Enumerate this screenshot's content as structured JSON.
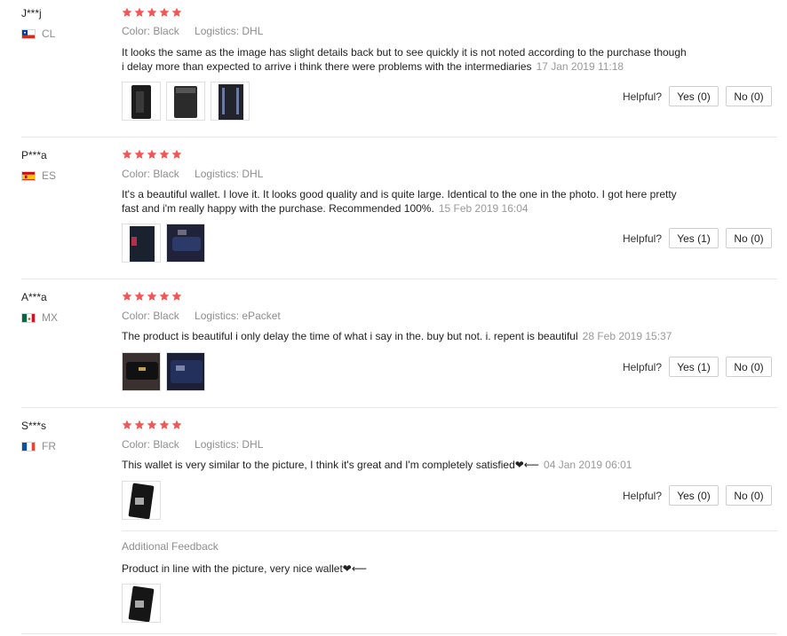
{
  "reviews": [
    {
      "user": "J***j",
      "country": "CL",
      "rating": 5,
      "color": "Color: Black",
      "logistics": "Logistics: DHL",
      "text": "It looks the same as the image has slight details back but to see quickly it is not noted according to the purchase though i delay more than expected to arrive i think there were problems with the intermediaries",
      "date": "17 Jan 2019 11:18",
      "photos": [
        "wallet-photo",
        "wallet-photo",
        "wallet-photo"
      ],
      "helpful_label": "Helpful?",
      "yes": "Yes (0)",
      "no": "No (0)"
    },
    {
      "user": "P***a",
      "country": "ES",
      "rating": 5,
      "color": "Color: Black",
      "logistics": "Logistics: DHL",
      "text": "It's a beautiful wallet. I love it. It looks good quality and is quite large. Identical to the one in the photo. I got here pretty fast and i'm really happy with the purchase. Recommended 100%.",
      "date": "15 Feb 2019 16:04",
      "photos": [
        "wallet-photo",
        "wallet-photo"
      ],
      "helpful_label": "Helpful?",
      "yes": "Yes (1)",
      "no": "No (0)"
    },
    {
      "user": "A***a",
      "country": "MX",
      "rating": 5,
      "color": "Color: Black",
      "logistics": "Logistics: ePacket",
      "text": "The product is beautiful i only delay the time of what i say in the. buy but not. i. repent is beautiful",
      "date": "28 Feb 2019 15:37",
      "photos": [
        "wallet-photo",
        "wallet-photo"
      ],
      "helpful_label": "Helpful?",
      "yes": "Yes (1)",
      "no": "No (0)"
    },
    {
      "user": "S***s",
      "country": "FR",
      "rating": 5,
      "color": "Color: Black",
      "logistics": "Logistics: DHL",
      "text": "This wallet is very similar to the picture, I think it's great and I'm completely satisfied❤⟵",
      "date": "04 Jan 2019 06:01",
      "photos": [
        "wallet-photo"
      ],
      "helpful_label": "Helpful?",
      "yes": "Yes (0)",
      "no": "No (0)",
      "additional_title": "Additional Feedback",
      "additional_text": "Product in line with the picture, very nice wallet❤⟵",
      "additional_photos": [
        "wallet-photo"
      ]
    }
  ],
  "colors": {
    "star": "#f25757",
    "meta": "#8e8e8e",
    "date": "#999999",
    "border": "#e8e8e8"
  }
}
